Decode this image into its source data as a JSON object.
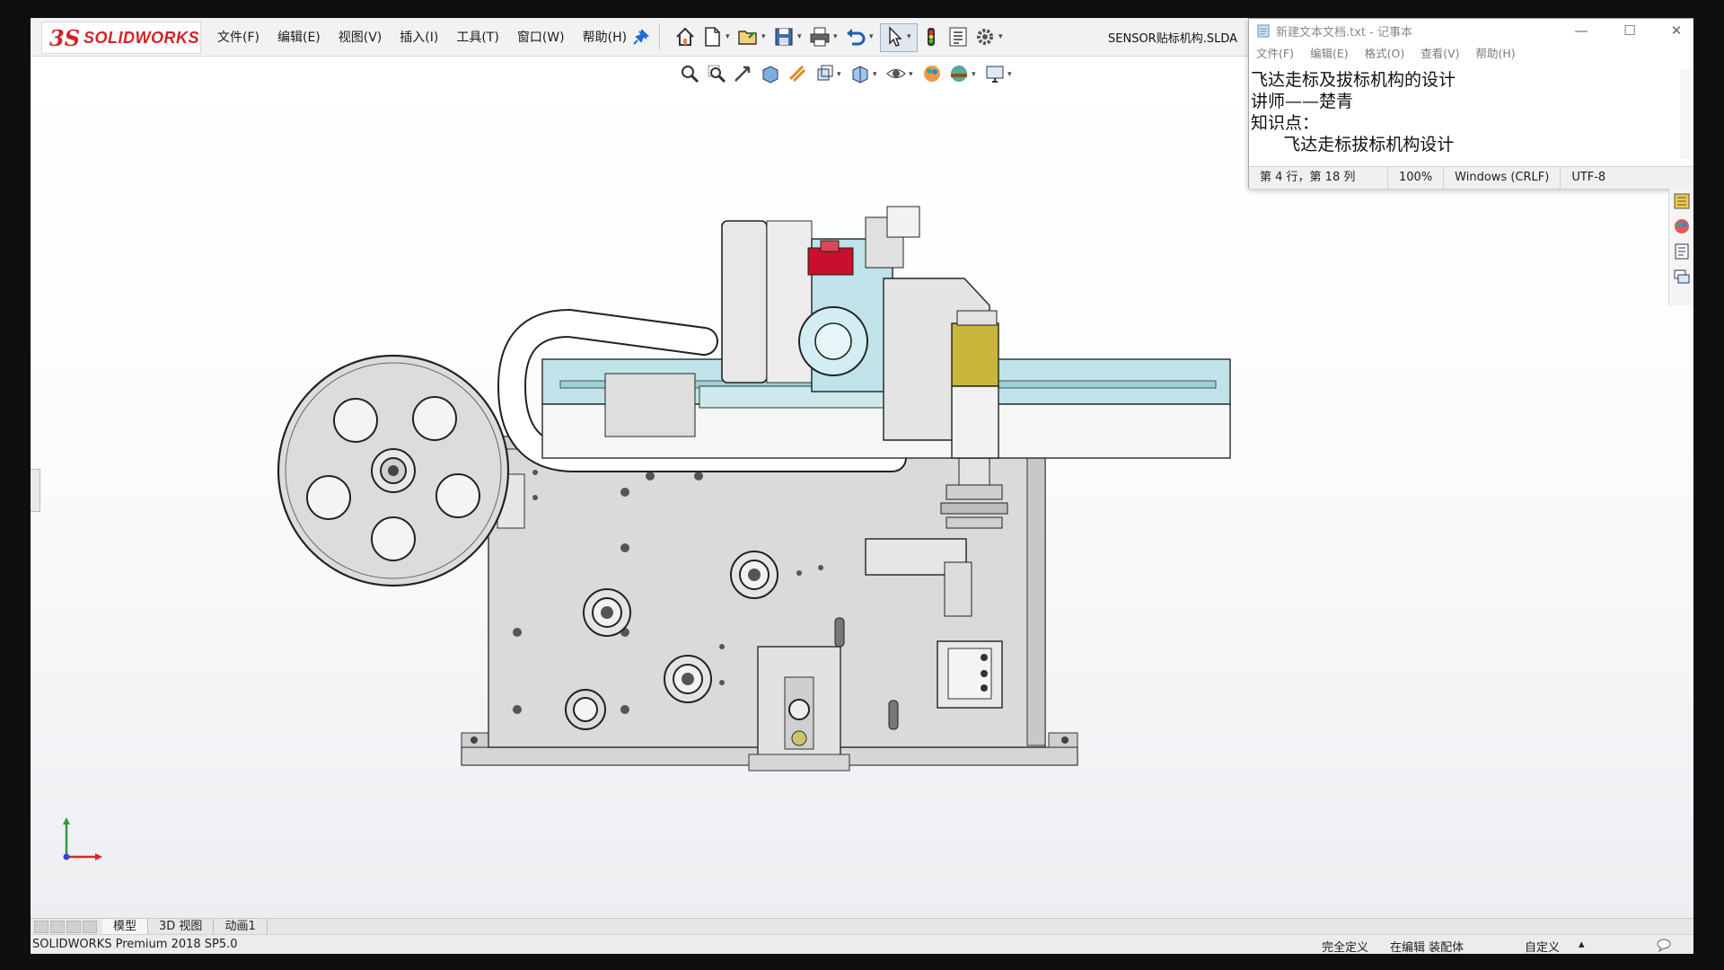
{
  "app": {
    "logo_ds": "3S",
    "logo_text": "SOLIDWORKS",
    "document_title": "SENSOR贴标机构.SLDASM"
  },
  "menu": [
    "文件(F)",
    "编辑(E)",
    "视图(V)",
    "插入(I)",
    "工具(T)",
    "窗口(W)",
    "帮助(H)"
  ],
  "notepad": {
    "title": "新建文本文档.txt - 记事本",
    "menu": [
      "文件(F)",
      "编辑(E)",
      "格式(O)",
      "查看(V)",
      "帮助(H)"
    ],
    "lines": [
      "飞达走标及拔标机构的设计",
      "讲师——楚青",
      "知识点：",
      "      飞达走标拔标机构设计"
    ],
    "status": {
      "position": "第 4 行，第 18 列",
      "zoom": "100%",
      "line_ending": "Windows (CRLF)",
      "encoding": "UTF-8"
    }
  },
  "tabs": [
    "模型",
    "3D 视图",
    "动画1"
  ],
  "status_bar": {
    "product": "SOLIDWORKS Premium 2018 SP5.0",
    "state": "完全定义",
    "mode": "在编辑 装配体",
    "custom": "自定义"
  },
  "colors": {
    "brand_red": "#d2232a",
    "part_cyan": "#bfe3e8",
    "part_yellow": "#c9b53a",
    "part_red": "#c8102e",
    "frame_gray": "#d9d9d9"
  }
}
